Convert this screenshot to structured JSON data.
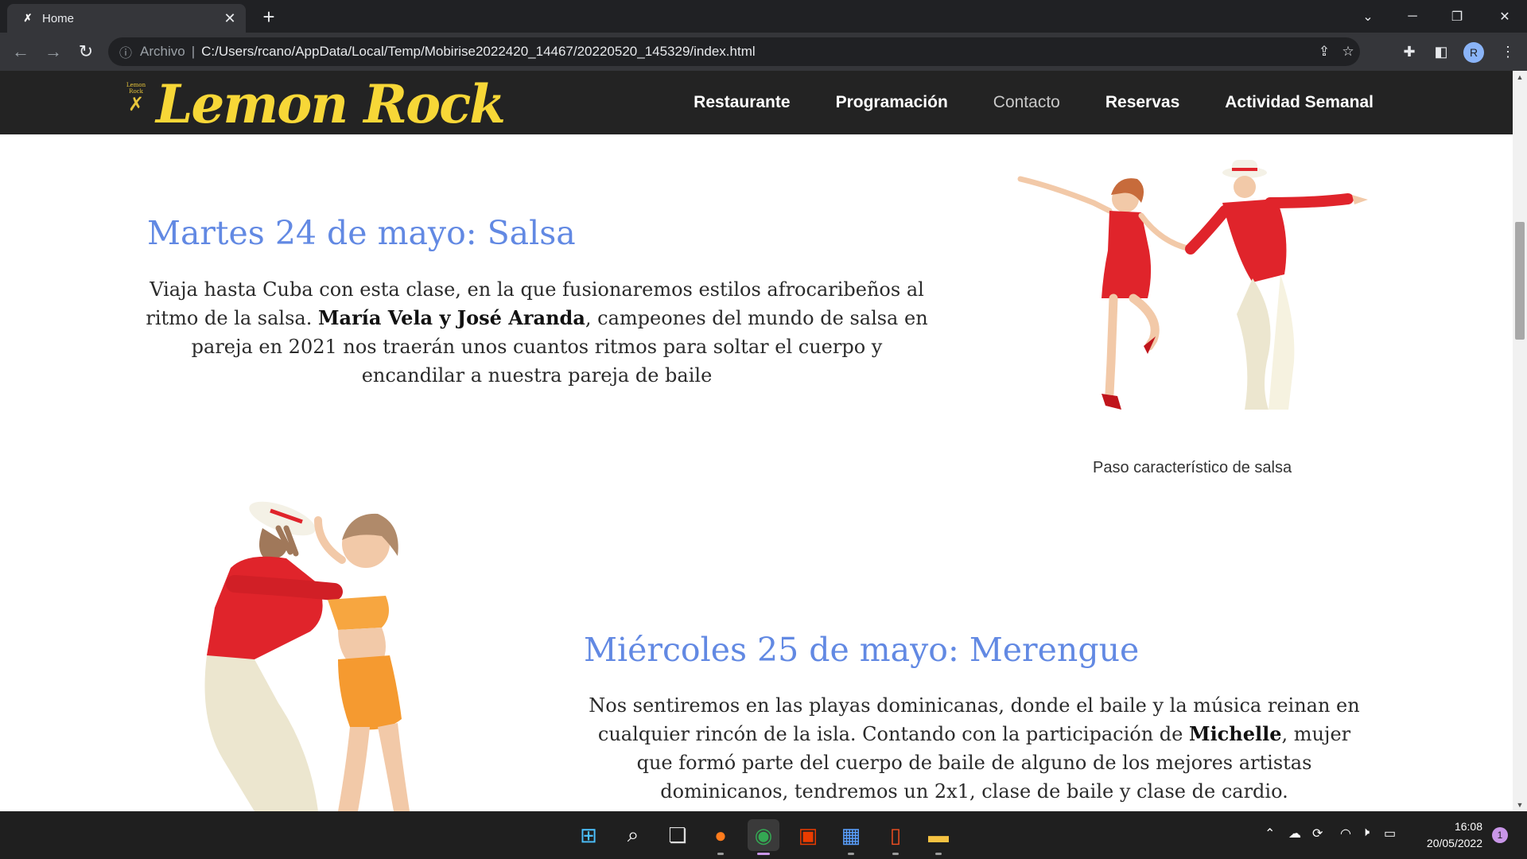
{
  "browser": {
    "tab_title": "Home",
    "tab_close": "✕",
    "new_tab": "+",
    "scheme_label": "Archivo",
    "separator": "|",
    "url": "C:/Users/rcano/AppData/Local/Temp/Mobirise2022420_14467/20220520_145329/index.html",
    "avatar_letter": "R"
  },
  "site": {
    "logo_small_text": "Lemon Rock",
    "logo_text": "Lemon Rock",
    "menu": [
      "Restaurante",
      "Programación",
      "Contacto",
      "Reservas",
      "Actividad Semanal"
    ]
  },
  "events": [
    {
      "heading": "Martes 24 de mayo: Salsa",
      "para_before": "Viaja hasta Cuba con esta clase, en la que fusionaremos estilos afrocaribeños al ritmo de la salsa. ",
      "para_bold": "María Vela y José Aranda",
      "para_after": ", campeones del mundo de salsa en pareja en 2021 nos traerán unos cuantos ritmos para soltar el cuerpo y encandilar a nuestra pareja de baile",
      "caption": "Paso característico de salsa"
    },
    {
      "heading": "Miércoles 25 de mayo: Merengue",
      "para_before": "Nos sentiremos en las playas dominicanas, donde el baile y la música reinan en cualquier rincón de la isla. Contando con la participación de ",
      "para_bold": "Michelle",
      "para_after": ", mujer que formó parte del cuerpo de baile de alguno de los mejores artistas dominicanos, tendremos un 2x1, clase de baile y clase de cardio."
    }
  ],
  "taskbar": {
    "time": "16:08",
    "date": "20/05/2022",
    "notifications": "1"
  },
  "colors": {
    "heading": "#6289e3",
    "logo": "#f7d737",
    "nav_bg": "#232323"
  }
}
